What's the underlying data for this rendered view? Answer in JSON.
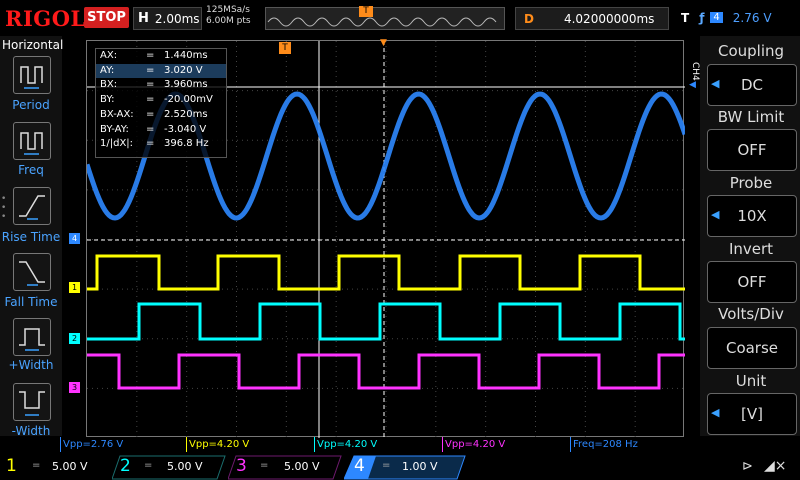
{
  "header": {
    "brand": "RIGOL",
    "run_state": "STOP",
    "timebase_label": "H",
    "timebase_value": "2.00ms",
    "sample_rate": "125MSa/s",
    "memory_depth": "6.00M pts",
    "delay_label": "D",
    "delay_value": "4.02000000ms",
    "trigger_label": "T",
    "trigger_edge_icon": "rising-edge-icon",
    "trigger_source": "4",
    "trigger_level": "2.76 V"
  },
  "left_menu": {
    "title": "Horizontal",
    "items": [
      {
        "label": "Period",
        "icon": "period-icon"
      },
      {
        "label": "Freq",
        "icon": "freq-icon"
      },
      {
        "label": "Rise Time",
        "icon": "rise-time-icon"
      },
      {
        "label": "Fall Time",
        "icon": "fall-time-icon"
      },
      {
        "label": "+Width",
        "icon": "positive-width-icon"
      },
      {
        "label": "-Width",
        "icon": "negative-width-icon"
      }
    ]
  },
  "right_menu": {
    "channel_tag": "CH4",
    "items": [
      {
        "title": "Coupling",
        "value": "DC"
      },
      {
        "title": "BW Limit",
        "value": "OFF"
      },
      {
        "title": "Probe",
        "value": "10X"
      },
      {
        "title": "Invert",
        "value": "OFF"
      },
      {
        "title": "Volts/Div",
        "value": "Coarse"
      },
      {
        "title": "Unit",
        "value": "[V]"
      }
    ]
  },
  "cursor_panel": {
    "rows": [
      {
        "key": "AX:",
        "eq": "=",
        "value": "1.440ms"
      },
      {
        "key": "AY:",
        "eq": "=",
        "value": "3.020 V"
      },
      {
        "key": "BX:",
        "eq": "=",
        "value": "3.960ms"
      },
      {
        "key": "BY:",
        "eq": "=",
        "value": "-20.00mV"
      },
      {
        "key": "BX-AX:",
        "eq": "=",
        "value": "2.520ms"
      },
      {
        "key": "BY-AY:",
        "eq": "=",
        "value": "-3.040 V"
      },
      {
        "key": "1/|dX|:",
        "eq": "=",
        "value": "396.8 Hz"
      }
    ]
  },
  "measurements": [
    {
      "text": "Vpp=2.76 V",
      "color": "#2d88ff"
    },
    {
      "text": "Vpp=4.20 V",
      "color": "#ffff00"
    },
    {
      "text": "Vpp=4.20 V",
      "color": "#00ffff"
    },
    {
      "text": "Vpp=4.20 V",
      "color": "#ff33ff"
    },
    {
      "text": "Freq=208 Hz",
      "color": "#2d88ff"
    }
  ],
  "channels": [
    {
      "num": "1",
      "coupling": "=",
      "scale": "5.00 V",
      "color": "#ffff00"
    },
    {
      "num": "2",
      "coupling": "=",
      "scale": "5.00 V",
      "color": "#00ffff"
    },
    {
      "num": "3",
      "coupling": "=",
      "scale": "5.00 V",
      "color": "#ff33ff"
    },
    {
      "num": "4",
      "coupling": "=",
      "scale": "1.00 V",
      "color": "#2d88ff"
    }
  ],
  "markers": {
    "ch1": "1",
    "ch2": "2",
    "ch3": "3",
    "ch4": "4",
    "trigger": "T"
  },
  "status_icons": [
    "usb-icon",
    "speaker-mute-icon"
  ],
  "colors": {
    "ch1": "#ffff00",
    "ch2": "#00ffff",
    "ch3": "#ff33ff",
    "ch4": "#2d88ff",
    "trigger": "#ff8c1a"
  }
}
